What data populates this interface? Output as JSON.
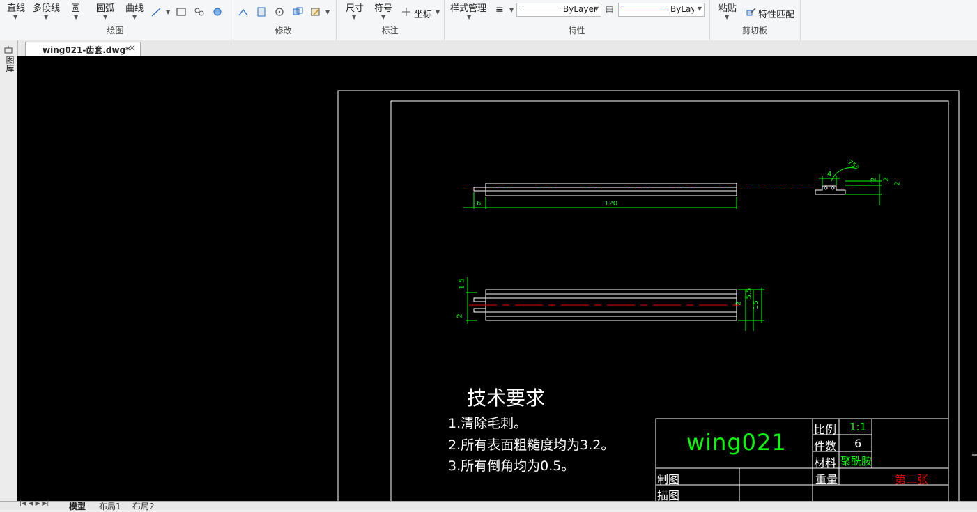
{
  "ribbon": {
    "draw": {
      "label": "绘图",
      "line": "直线",
      "polyline": "多段线",
      "circle": "圆",
      "arc": "圆弧",
      "curve": "曲线"
    },
    "modify": {
      "label": "修改"
    },
    "annotate": {
      "label": "标注",
      "dimension": "尺寸",
      "symbol": "符号",
      "coordinate": "坐标"
    },
    "properties": {
      "label": "特性",
      "style_manager": "样式管理",
      "linetype": "ByLayer",
      "color": "ByLayer"
    },
    "clipboard": {
      "label": "剪切板",
      "paste": "粘贴",
      "match_properties": "特性匹配"
    }
  },
  "document_tab": {
    "title": "wing021-齿套.dwg*",
    "close": "×"
  },
  "side_panel": {
    "label": "图库"
  },
  "layout_tabs": [
    "模型",
    "布局1",
    "布局2"
  ],
  "drawing": {
    "dims_front": {
      "left": "6",
      "length": "120"
    },
    "dims_side": {
      "w": "4",
      "angle": "75°",
      "h1": "2",
      "h2": "2",
      "h3": "2"
    },
    "dims_top": {
      "a": "1.5",
      "b": "2",
      "c": "5.5",
      "d": "2",
      "e": "15"
    },
    "tech_req": {
      "title": "技术要求",
      "items": [
        "1.清除毛刺。",
        "2.所有表面粗糙度均为3.2。",
        "3.所有倒角均为0.5。"
      ]
    },
    "title_block": {
      "name": "wing021",
      "scale_label": "比例",
      "scale_value": "1:1",
      "count_label": "件数",
      "count_value": "6",
      "material_label": "材料",
      "material_value": "聚酰胺",
      "weight_label": "重量",
      "sheet": "第二张",
      "drawn_label": "制图",
      "traced_label": "描图"
    }
  },
  "colors": {
    "canvas": "#000000",
    "line_white": "#ffffff",
    "center_red": "#ff0000",
    "dim_green": "#00ff00"
  }
}
